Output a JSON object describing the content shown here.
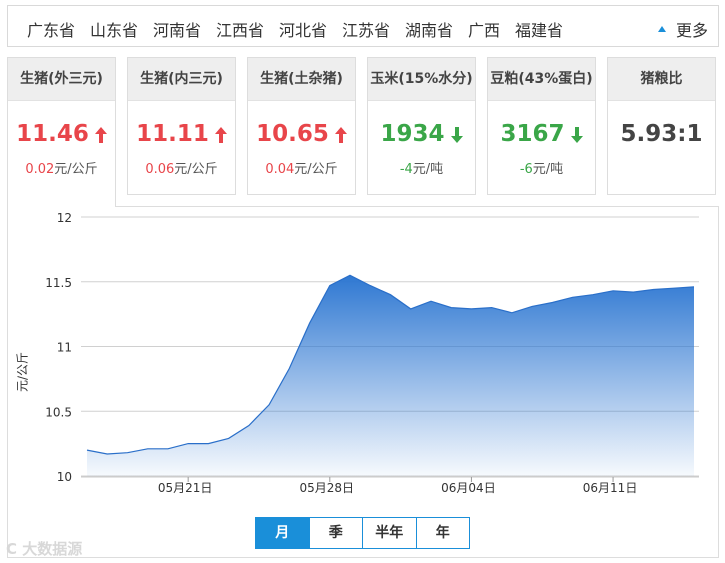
{
  "provinces": [
    "广东省",
    "山东省",
    "河南省",
    "江西省",
    "河北省",
    "江苏省",
    "湖南省",
    "广西",
    "福建省"
  ],
  "more_label": "更多",
  "cards": [
    {
      "name": "生猪(外三元)",
      "price": "11.46",
      "direction": "up",
      "change": "0.02",
      "unit": "元/公斤",
      "active": true
    },
    {
      "name": "生猪(内三元)",
      "price": "11.11",
      "direction": "up",
      "change": "0.06",
      "unit": "元/公斤"
    },
    {
      "name": "生猪(土杂猪)",
      "price": "10.65",
      "direction": "up",
      "change": "0.04",
      "unit": "元/公斤"
    },
    {
      "name": "玉米(15%水分)",
      "price": "1934",
      "direction": "down",
      "change": "-4",
      "unit": "元/吨"
    },
    {
      "name": "豆粕(43%蛋白)",
      "price": "3167",
      "direction": "down",
      "change": "-6",
      "unit": "元/吨"
    },
    {
      "name": "猪粮比",
      "price": "5.93:1",
      "direction": "flat",
      "change": "",
      "unit": ""
    }
  ],
  "range_tabs": [
    "月",
    "季",
    "半年",
    "年"
  ],
  "active_range": 0,
  "watermark": "C 大数据源",
  "colors": {
    "up": "#e8454a",
    "down": "#3aa648",
    "accent": "#1a8fd9",
    "area_top": "#2f78d2"
  },
  "chart_data": {
    "type": "area",
    "title": "",
    "xlabel": "",
    "ylabel": "元/公斤",
    "ylim": [
      10,
      12
    ],
    "yticks": [
      10,
      10.5,
      11,
      11.5,
      12
    ],
    "x_ticks": [
      "05月21日",
      "05月28日",
      "06月04日",
      "06月11日"
    ],
    "x_tick_index": [
      5,
      12,
      19,
      26
    ],
    "grid": true,
    "legend": "none",
    "values": [
      10.2,
      10.17,
      10.18,
      10.21,
      10.21,
      10.25,
      10.25,
      10.29,
      10.39,
      10.55,
      10.83,
      11.18,
      11.47,
      11.55,
      11.47,
      11.4,
      11.29,
      11.35,
      11.3,
      11.29,
      11.3,
      11.26,
      11.31,
      11.34,
      11.38,
      11.4,
      11.43,
      11.42,
      11.44,
      11.45,
      11.46
    ]
  }
}
